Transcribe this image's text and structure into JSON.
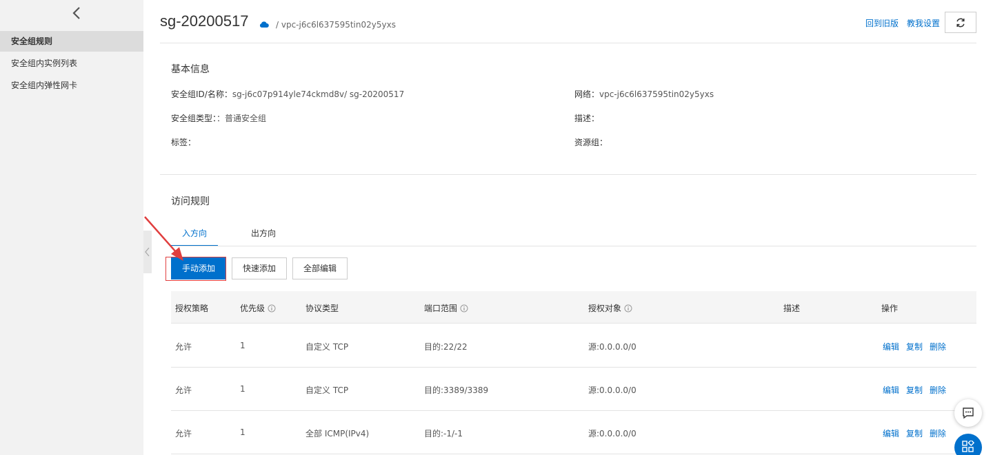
{
  "sidebar": {
    "items": [
      {
        "label": "安全组规则"
      },
      {
        "label": "安全组内实例列表"
      },
      {
        "label": "安全组内弹性网卡"
      }
    ]
  },
  "header": {
    "title": "sg-20200517",
    "breadcrumb": "/ vpc-j6c6l637595tin02y5yxs",
    "back_old_label": "回到旧版",
    "teach_label": "教我设置"
  },
  "basic": {
    "section_title": "基本信息",
    "id_label": "安全组ID/名称：",
    "id_value": "sg-j6c07p914yle74ckmd8v/ sg-20200517",
    "type_label": "安全组类型：",
    "type_value": "：普通安全组",
    "tag_label": "标签：",
    "network_label": "网络：",
    "network_value": "vpc-j6c6l637595tin02y5yxs",
    "desc_label": "描述：",
    "rg_label": "资源组："
  },
  "rules": {
    "section_title": "访问规则",
    "tabs": [
      {
        "label": "入方向"
      },
      {
        "label": "出方向"
      }
    ],
    "buttons": {
      "manual_add": "手动添加",
      "quick_add": "快速添加",
      "edit_all": "全部编辑"
    },
    "columns": [
      "授权策略",
      "优先级",
      "协议类型",
      "端口范围",
      "授权对象",
      "描述",
      "操作"
    ],
    "rows": [
      {
        "policy": "允许",
        "priority": "1",
        "protocol": "自定义 TCP",
        "port": "目的:22/22",
        "target": "源:0.0.0.0/0",
        "desc": ""
      },
      {
        "policy": "允许",
        "priority": "1",
        "protocol": "自定义 TCP",
        "port": "目的:3389/3389",
        "target": "源:0.0.0.0/0",
        "desc": ""
      },
      {
        "policy": "允许",
        "priority": "1",
        "protocol": "全部 ICMP(IPv4)",
        "port": "目的:-1/-1",
        "target": "源:0.0.0.0/0",
        "desc": ""
      }
    ],
    "actions": {
      "edit": "编辑",
      "copy": "复制",
      "delete": "删除"
    }
  },
  "colors": {
    "accent": "#0070cc",
    "highlight": "#e03e3e",
    "sidebar_bg": "#f2f2f2"
  }
}
